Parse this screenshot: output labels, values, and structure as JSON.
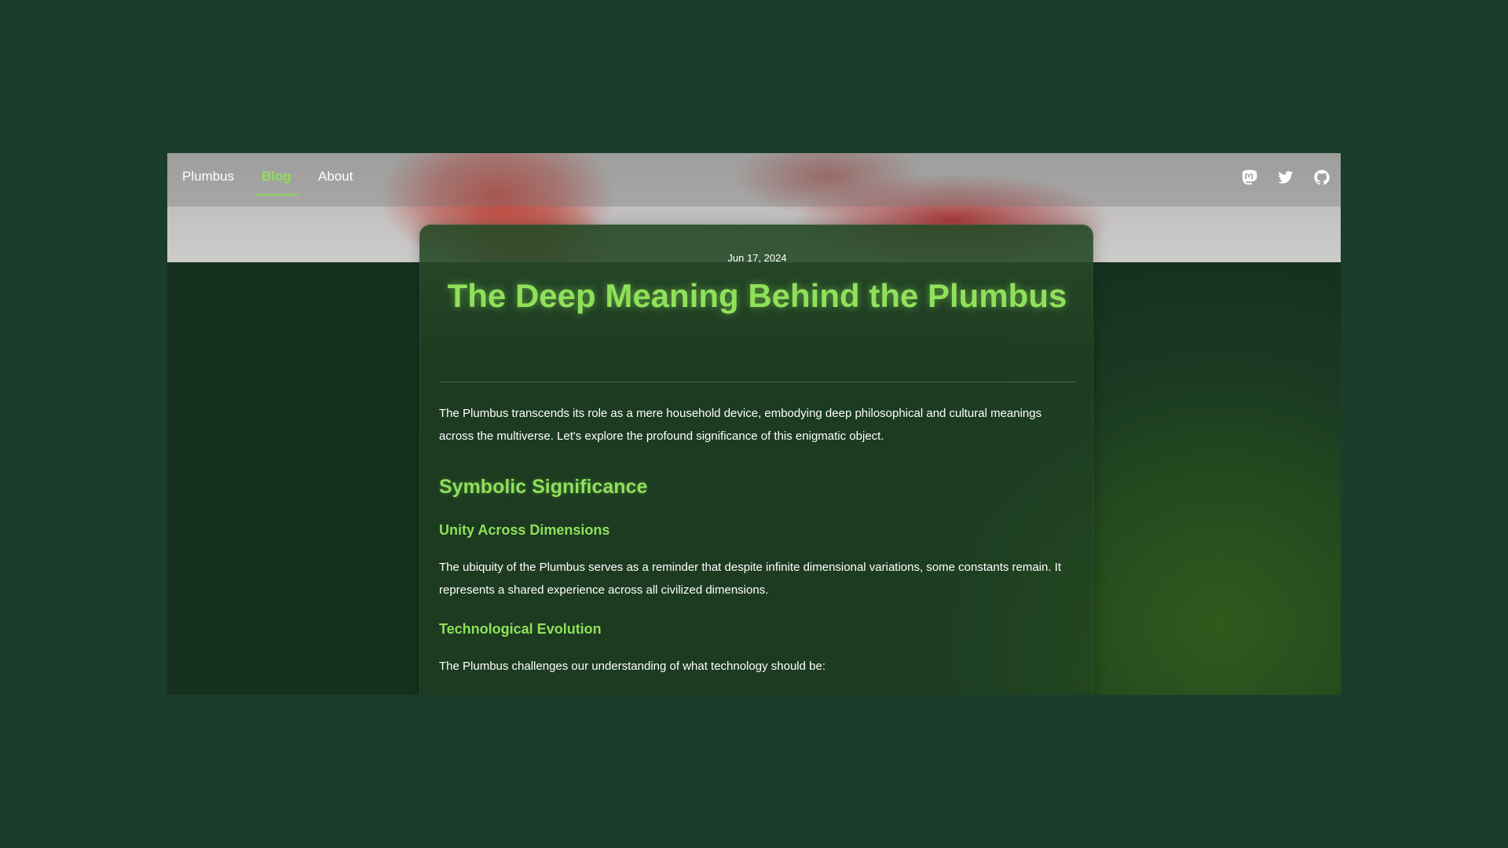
{
  "nav": {
    "home_label": "Plumbus",
    "blog_label": "Blog",
    "about_label": "About",
    "active": "Blog"
  },
  "social": {
    "icons": [
      "mastodon-icon",
      "twitter-icon",
      "github-icon"
    ]
  },
  "post": {
    "date": "Jun 17, 2024",
    "title": "The Deep Meaning Behind the Plumbus",
    "intro": "The Plumbus transcends its role as a mere household device, embodying deep philosophical and cultural meanings across the multiverse. Let's explore the profound significance of this enigmatic object.",
    "section_heading": "Symbolic Significance",
    "subsection1_heading": "Unity Across Dimensions",
    "subsection1_text": "The ubiquity of the Plumbus serves as a reminder that despite infinite dimensional variations, some constants remain. It represents a shared experience across all civilized dimensions.",
    "subsection2_heading": "Technological Evolution",
    "subsection2_text": "The Plumbus challenges our understanding of what technology should be:"
  },
  "colors": {
    "background": "#1a3d2c",
    "accent": "#8fe05a",
    "text": "#ffffff"
  }
}
